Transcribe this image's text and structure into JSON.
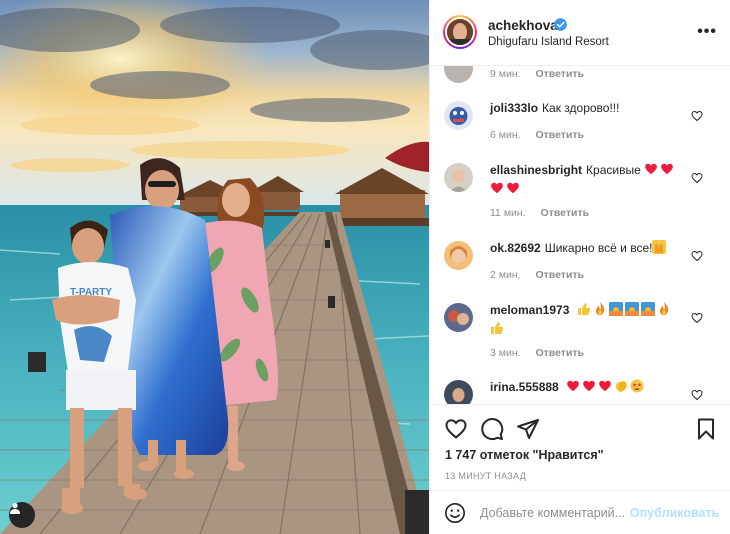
{
  "post": {
    "username": "achekhova",
    "location": "Dhigufaru Island Resort",
    "likes": "1 747 отметок \"Нравится\"",
    "time": "13 МИНУТ НАЗАД"
  },
  "comments": [
    {
      "user": "",
      "text": "",
      "time": "9 мин.",
      "reply": "Ответить"
    },
    {
      "user": "joli333lo",
      "text": "Как здорово!!!",
      "time": "6 мин.",
      "reply": "Ответить"
    },
    {
      "user": "ellashinesbright",
      "text": "Красивые",
      "emoji": [
        "red-heart",
        "red-heart",
        "red-heart",
        "red-heart"
      ],
      "time": "11 мин.",
      "reply": "Ответить"
    },
    {
      "user": "ok.82692",
      "text": "Шикарно всё и все!",
      "emoji": [
        "raising-hands"
      ],
      "time": "2 мин.",
      "reply": "Ответить"
    },
    {
      "user": "meloman1973",
      "text": "",
      "emoji": [
        "thumbs-up",
        "fire",
        "sunset-photo",
        "sunset-photo",
        "sunset-photo",
        "fire",
        "thumbs-up"
      ],
      "time": "3 мин.",
      "reply": "Ответить"
    },
    {
      "user": "irina.555888",
      "text": "",
      "emoji": [
        "red-heart",
        "red-heart",
        "red-heart",
        "clapping-hands",
        "star-struck"
      ],
      "time": "",
      "reply": ""
    }
  ],
  "composer": {
    "placeholder": "Добавьте комментарий...",
    "publish": "Опубликовать"
  },
  "icons": {
    "verified": "verified-badge-icon",
    "like": "heart-outline-icon",
    "comment": "comment-bubble-icon",
    "share": "paper-plane-icon",
    "save": "bookmark-icon",
    "emoji": "smiley-icon",
    "more": "more-options-icon",
    "tag": "tagged-user-icon"
  },
  "colors": {
    "verified": "#3897f0",
    "publish_disabled": "#b2dffc",
    "muted_text": "#8e8e8e",
    "heart": "#ed1c3a"
  }
}
